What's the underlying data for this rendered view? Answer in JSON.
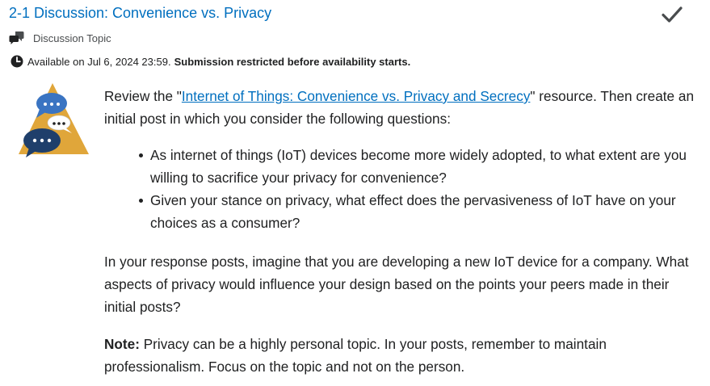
{
  "header": {
    "title": "2-1 Discussion: Convenience vs. Privacy",
    "topic_type": "Discussion Topic",
    "availability": "Available on Jul 6, 2024 23:59.",
    "restriction": "Submission restricted before availability starts."
  },
  "icons": {
    "check": "checkmark-icon",
    "topic": "discussion-icon",
    "availability": "clock-icon",
    "hero": "discussion-bubbles-illustration"
  },
  "colors": {
    "link": "#006fbf",
    "text": "#202122",
    "hero_triangle": "#e0a63a",
    "hero_bubble_dark": "#1f3f6b",
    "hero_bubble_blue": "#3a74c2"
  },
  "body": {
    "intro_before": "Review the \"",
    "intro_link": "Internet of Things: Convenience vs. Privacy and Secrecy",
    "intro_after": "\" resource. Then create an initial post in which you consider the following questions:",
    "questions": [
      "As internet of things (IoT) devices become more widely adopted, to what extent are you willing to sacrifice your privacy for convenience?",
      "Given your stance on privacy, what effect does the pervasiveness of IoT have on your choices as a consumer?"
    ],
    "response": "In your response posts, imagine that you are developing a new IoT device for a company. What aspects of privacy would influence your design based on the points your peers made in their initial posts?",
    "note_label": "Note:",
    "note_text": " Privacy can be a highly personal topic. In your posts, remember to maintain professionalism. Focus on the topic and not on the person."
  }
}
